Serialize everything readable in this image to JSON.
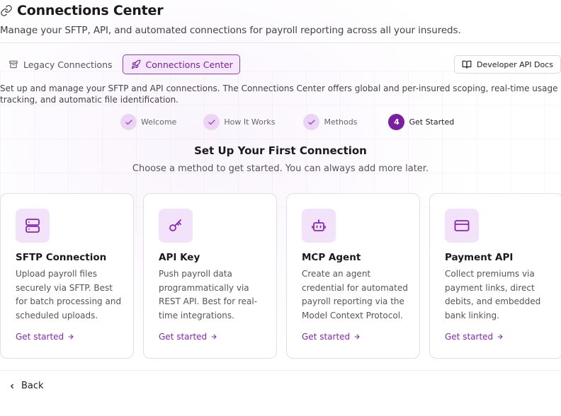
{
  "header": {
    "title": "Connections Center",
    "subtitle": "Manage your SFTP, API, and automated connections for payroll reporting across all your insureds."
  },
  "tabs": [
    {
      "label": "Legacy Connections",
      "icon": "archive-icon",
      "active": false
    },
    {
      "label": "Connections Center",
      "icon": "rocket-icon",
      "active": true
    }
  ],
  "docs_button": {
    "label": "Developer API Docs",
    "icon": "book-icon"
  },
  "intro": "Set up and manage your SFTP and API connections. The Connections Center offers global and per-insured scoping, real-time usage tracking, and automatic file identification.",
  "stepper": {
    "steps": [
      {
        "label": "Welcome",
        "state": "done"
      },
      {
        "label": "How It Works",
        "state": "done"
      },
      {
        "label": "Methods",
        "state": "done"
      },
      {
        "label": "Get Started",
        "state": "current",
        "number": "4"
      }
    ]
  },
  "section": {
    "title": "Set Up Your First Connection",
    "subtitle": "Choose a method to get started. You can always add more later."
  },
  "cards": [
    {
      "title": "SFTP Connection",
      "description": "Upload payroll files securely via SFTP. Best for batch processing and scheduled uploads.",
      "link": "Get started",
      "icon": "server-icon"
    },
    {
      "title": "API Key",
      "description": "Push payroll data programmatically via REST API. Best for real-time integrations.",
      "link": "Get started",
      "icon": "key-icon"
    },
    {
      "title": "MCP Agent",
      "description": "Create an agent credential for automated payroll reporting via the Model Context Protocol.",
      "link": "Get started",
      "icon": "bot-icon"
    },
    {
      "title": "Payment API",
      "description": "Collect premiums via payment links, direct debits, and embedded bank linking.",
      "link": "Get started",
      "icon": "credit-card-icon"
    }
  ],
  "back_button": {
    "label": "Back"
  },
  "colors": {
    "accent": "#7a1fa2",
    "accent_light": "#f2e3fa",
    "link": "#8a25b3"
  }
}
